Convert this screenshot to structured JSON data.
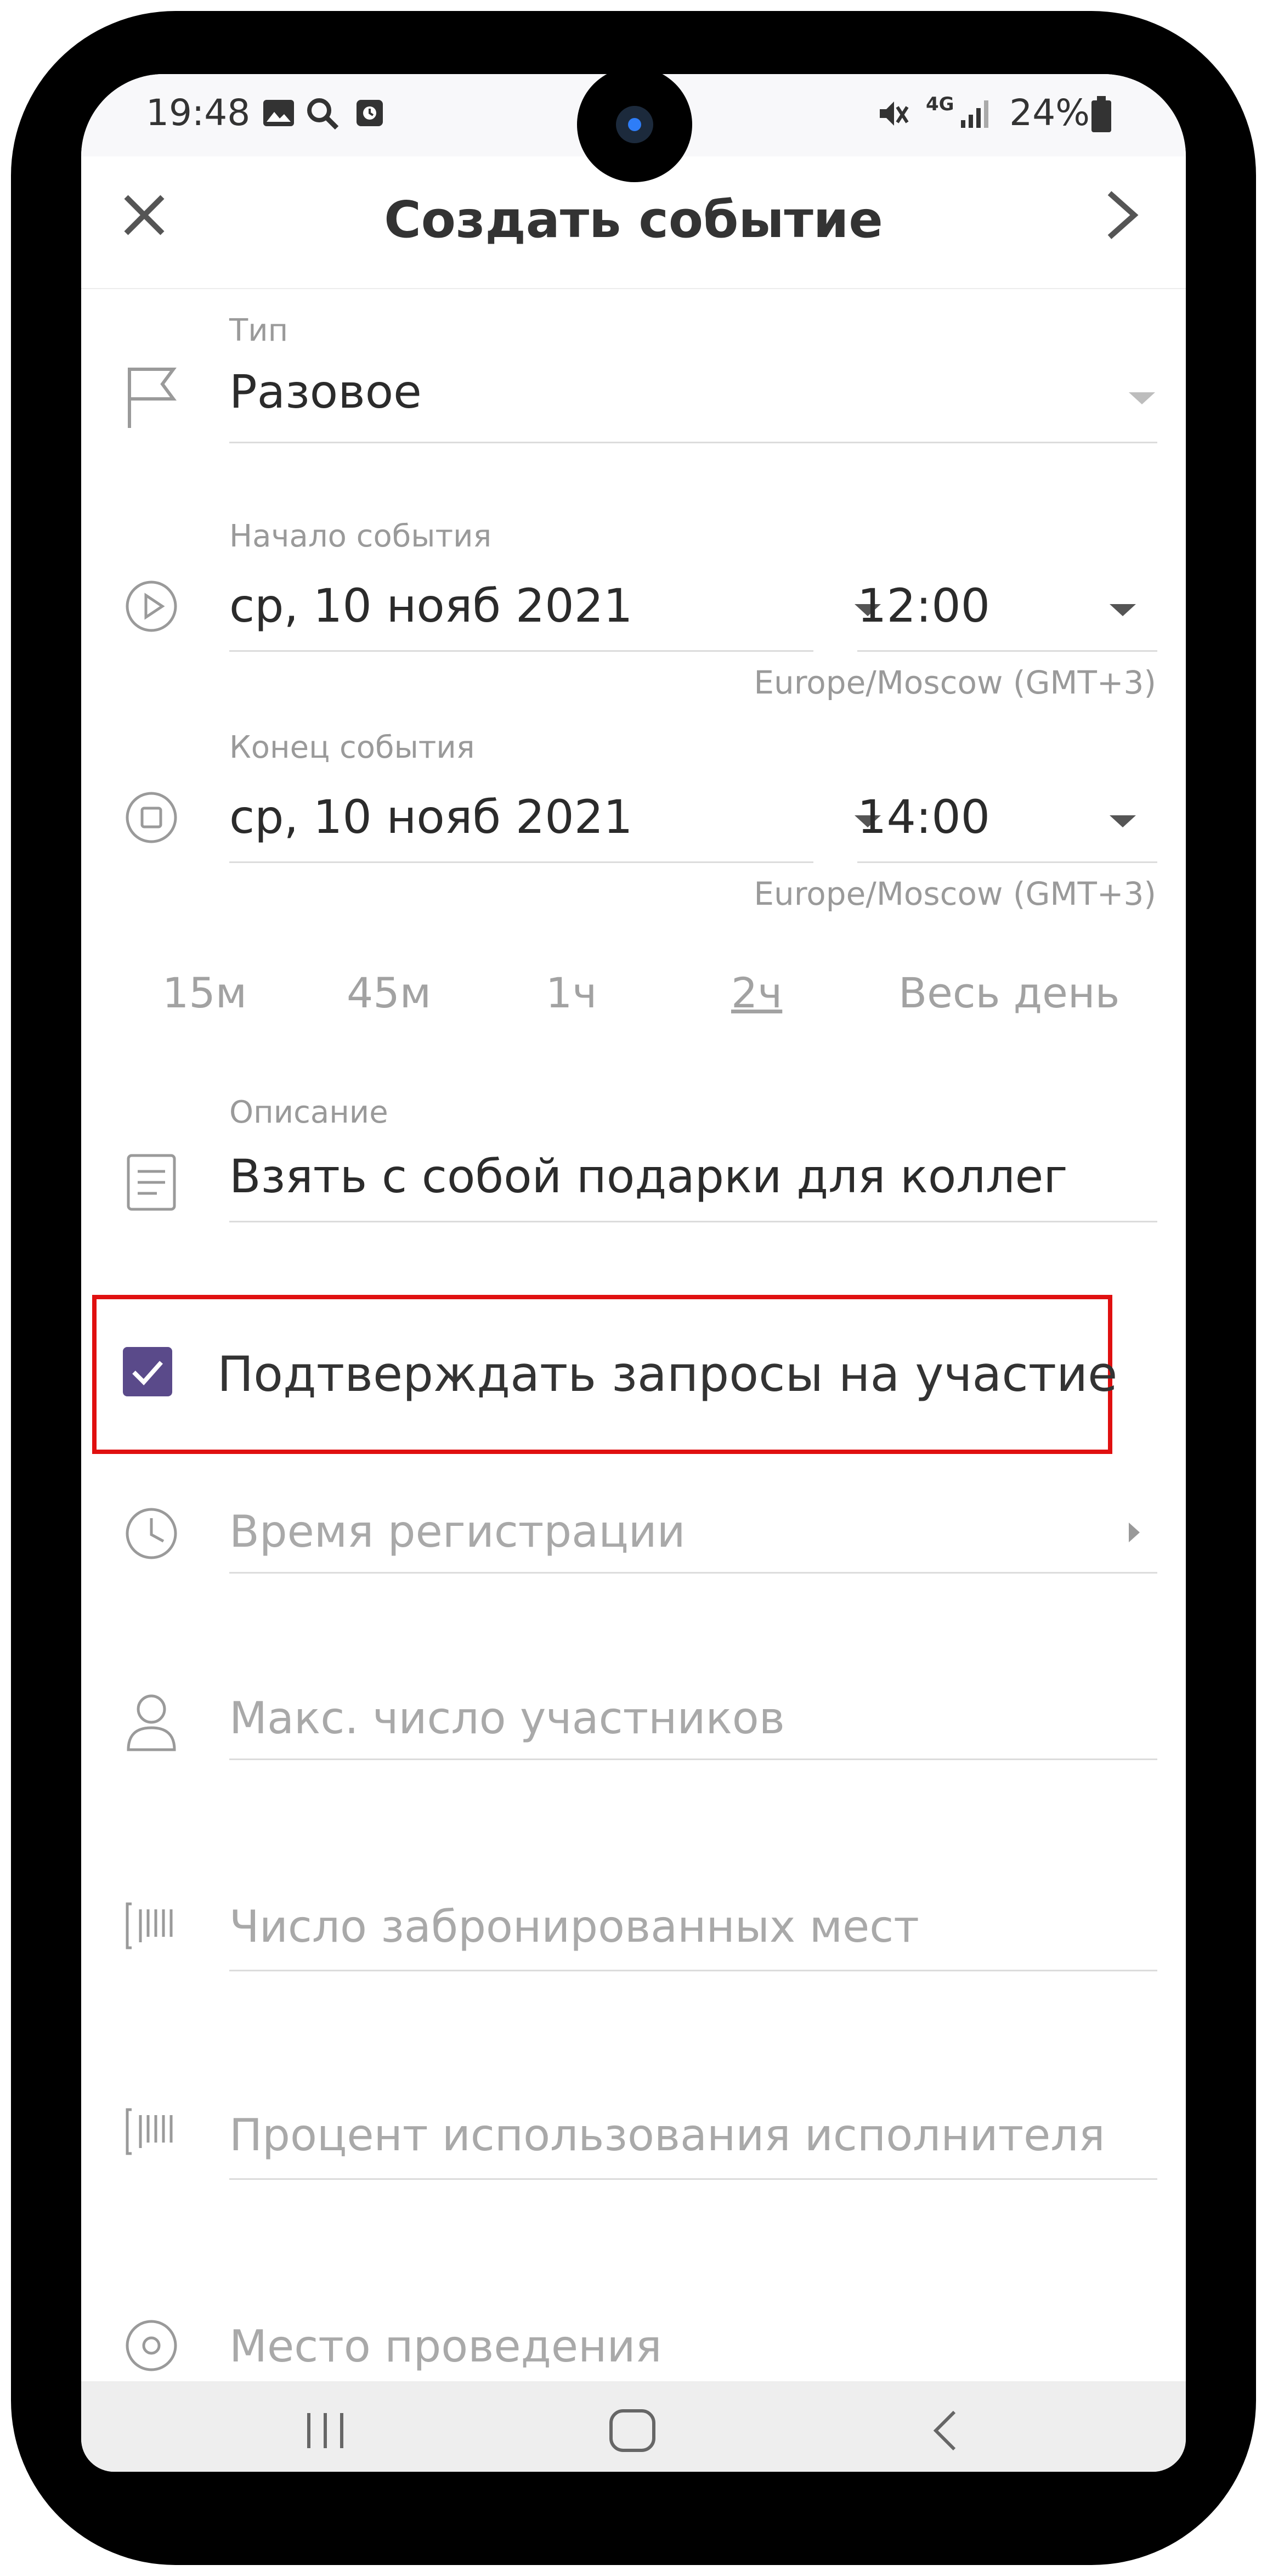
{
  "status_bar": {
    "time": "19:48",
    "battery": "24%",
    "network": "4G"
  },
  "header": {
    "title": "Создать событие",
    "close_icon": "close-icon",
    "next_icon": "chevron-right-icon"
  },
  "type_field": {
    "label": "Тип",
    "value": "Разовое"
  },
  "start": {
    "label": "Начало события",
    "date": "ср, 10 нояб 2021",
    "time": "12:00",
    "timezone": "Europe/Moscow (GMT+3)"
  },
  "end": {
    "label": "Конец события",
    "date": "ср, 10 нояб 2021",
    "time": "14:00",
    "timezone": "Europe/Moscow (GMT+3)"
  },
  "durations": [
    "15м",
    "45м",
    "1ч",
    "2ч",
    "Весь день"
  ],
  "selected_duration": "2ч",
  "description": {
    "label": "Описание",
    "value": "Взять с собой подарки для коллег"
  },
  "confirm_requests": {
    "label": "Подтверждать запросы на участие",
    "checked": true
  },
  "registration_time": {
    "placeholder": "Время регистрации"
  },
  "max_participants": {
    "placeholder": "Макс. число участников"
  },
  "booked_seats": {
    "placeholder": "Число забронированных мест"
  },
  "performer_usage": {
    "placeholder": "Процент использования исполнителя"
  },
  "venue": {
    "placeholder": "Место проведения"
  },
  "colors": {
    "accent": "#5a4a8a",
    "highlight": "#e01010"
  }
}
